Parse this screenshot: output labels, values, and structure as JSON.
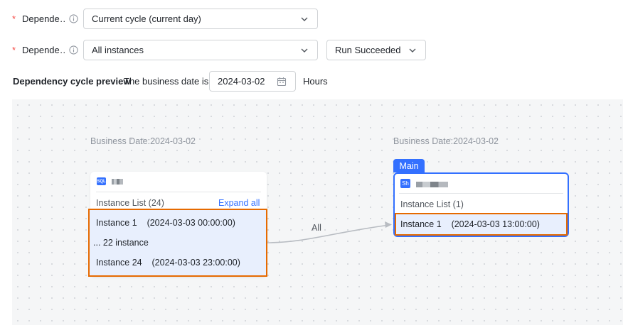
{
  "form": {
    "row1": {
      "label": "Depende…",
      "select_value": "Current cycle (current day)"
    },
    "row2": {
      "label": "Depende…",
      "select_value": "All instances",
      "status_value": "Run Succeeded"
    },
    "preview": {
      "label": "Dependency cycle preview",
      "business_date_label": "The business date is",
      "date_value": "2024-03-02",
      "unit": "Hours"
    }
  },
  "graph": {
    "left_node": {
      "business_date": "Business Date:2024-03-02",
      "type_badge": "SQL",
      "instance_list_label": "Instance List (24)",
      "expand_label": "Expand all",
      "rows": [
        "Instance 1    (2024-03-03 00:00:00)",
        "... 22 instance",
        "Instance 24    (2024-03-03 23:00:00)"
      ]
    },
    "edge_label": "All",
    "right_node": {
      "business_date": "Business Date:2024-03-02",
      "tag": "Main",
      "type_badge": "Sh",
      "instance_list_label": "Instance List (1)",
      "rows": [
        "Instance 1    (2024-03-03 13:00:00)"
      ]
    }
  },
  "colors": {
    "accent": "#3370ff",
    "highlight_border": "#e66a00",
    "required": "#f54a45"
  }
}
